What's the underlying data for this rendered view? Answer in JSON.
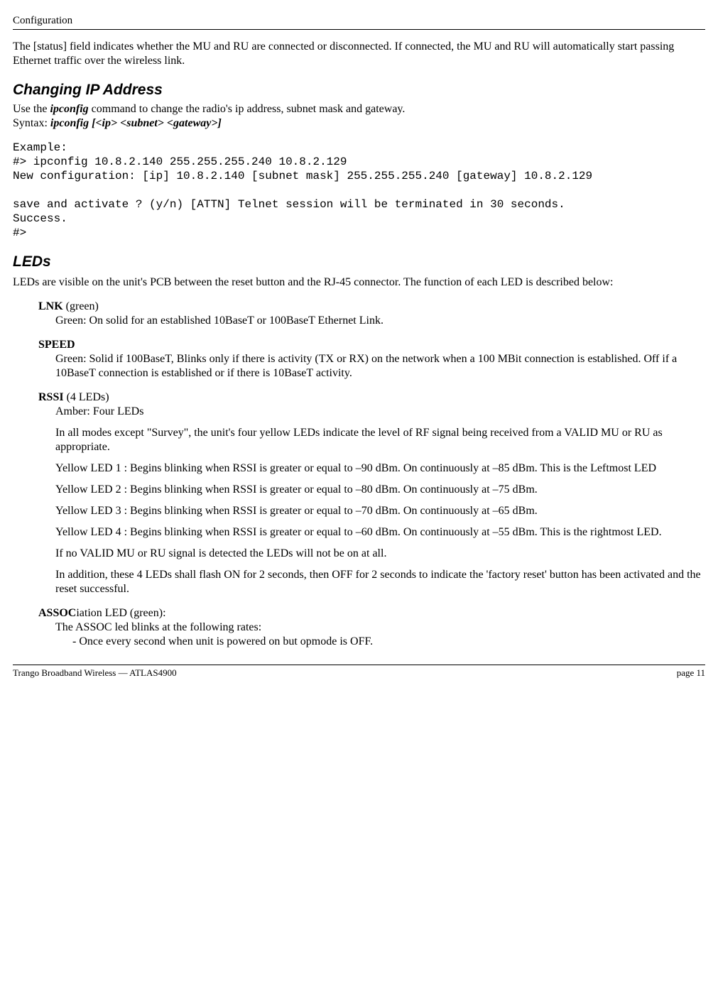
{
  "header": "Configuration",
  "intro_para": "The [status] field indicates whether the MU and RU are connected or disconnected.  If connected, the MU and RU will automatically start passing Ethernet traffic over the wireless link.",
  "section_ip_title": "Changing IP Address",
  "ip_line1_pre": "Use the ",
  "ip_line1_cmd": "ipconfig",
  "ip_line1_post": " command to change the radio's ip address, subnet mask and gateway.",
  "ip_line2_pre": "Syntax:  ",
  "ip_line2_syntax": "ipconfig [<ip> <subnet> <gateway>]",
  "example_block": "Example:\n#> ipconfig 10.8.2.140 255.255.255.240 10.8.2.129\nNew configuration: [ip] 10.8.2.140 [subnet mask] 255.255.255.240 [gateway] 10.8.2.129\n\nsave and activate ? (y/n) [ATTN] Telnet session will be terminated in 30 seconds.\nSuccess.\n#>",
  "section_leds_title": "LEDs",
  "leds_intro": "LEDs are visible on the unit's PCB between the reset button and the RJ-45 connector.  The function of each LED is described below:",
  "lnk_label": "LNK",
  "lnk_label_suffix": " (green)",
  "lnk_desc": "Green: On solid for an established 10BaseT or 100BaseT Ethernet Link.",
  "speed_label": "SPEED",
  "speed_desc": "Green: Solid if 100BaseT, Blinks only if there is activity (TX or RX) on the network when a 100 MBit connection is established.  Off if a 10BaseT connection is established or if there is 10BaseT activity.",
  "rssi_label": "RSSI",
  "rssi_label_suffix": "  (4  LEDs)",
  "rssi_line1": "Amber: Four LEDs",
  "rssi_para1": "In all modes except \"Survey\", the unit's four yellow LEDs indicate the level of RF signal being received from a VALID MU or RU as appropriate.",
  "rssi_y1": "Yellow LED 1 : Begins blinking when RSSI is greater or equal to –90 dBm. On continuously at –85 dBm. This is the Leftmost LED",
  "rssi_y2": "Yellow LED 2 : Begins blinking when RSSI is greater or equal to –80 dBm.  On continuously at –75 dBm.",
  "rssi_y3": "Yellow LED 3 : Begins blinking when RSSI is greater or equal to –70 dBm.  On continuously at –65 dBm.",
  "rssi_y4": "Yellow LED 4 : Begins blinking when RSSI is greater or equal to –60 dBm. On continuously at –55 dBm. This is the rightmost LED.",
  "rssi_novalid": "If no VALID MU or RU signal is detected the LEDs will not be on at all.",
  "rssi_flash": "In addition, these 4 LEDs shall flash ON for 2 seconds, then OFF for 2 seconds to indicate the 'factory reset' button has been activated and the reset successful.",
  "assoc_label": "ASSOC",
  "assoc_label_suffix": "iation LED (green):",
  "assoc_line1": "The ASSOC led blinks at the following rates:",
  "assoc_bullet1": "-  Once every second when unit is powered on but opmode is OFF.",
  "footer_left": "Trango Broadband Wireless — ATLAS4900",
  "footer_right": "page 11"
}
